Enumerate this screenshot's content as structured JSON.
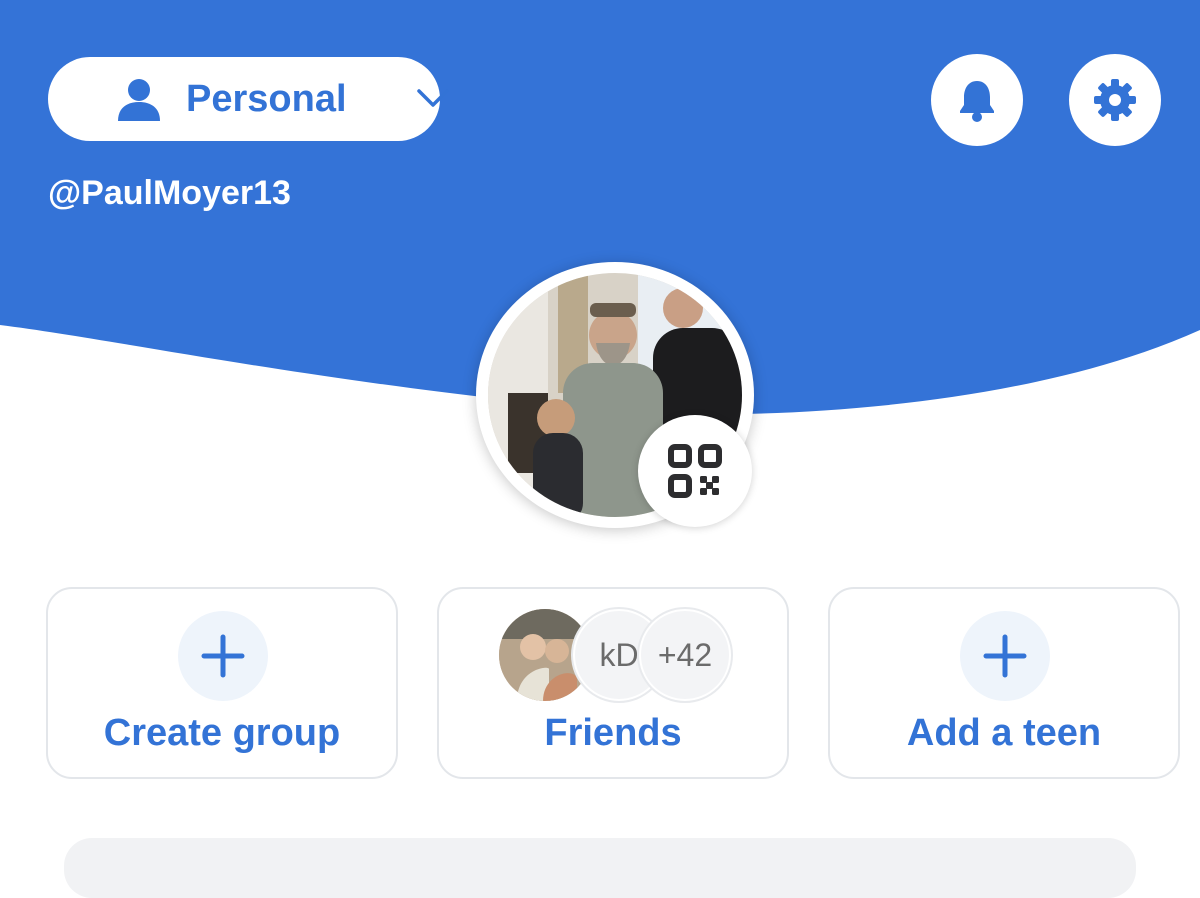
{
  "header": {
    "account_label": "Personal",
    "username": "@PaulMoyer13",
    "icons": {
      "account": "person-icon",
      "switcher": "chevron-down-icon",
      "notifications": "bell-icon",
      "settings": "gear-icon"
    }
  },
  "profile": {
    "avatar": "profile-photo",
    "qr_icon": "qr-code-icon"
  },
  "actions": [
    {
      "label": "Create group",
      "icon": "plus-icon"
    },
    {
      "label": "Friends",
      "avatars": [
        "friend-photo",
        "kD",
        "+42"
      ]
    },
    {
      "label": "Add a teen",
      "icon": "plus-icon"
    }
  ],
  "colors": {
    "brand_blue": "#3373d6",
    "header_blue": "#3473d7",
    "card_border": "#e3e6ea",
    "plus_circle_bg": "#eef4fb"
  }
}
